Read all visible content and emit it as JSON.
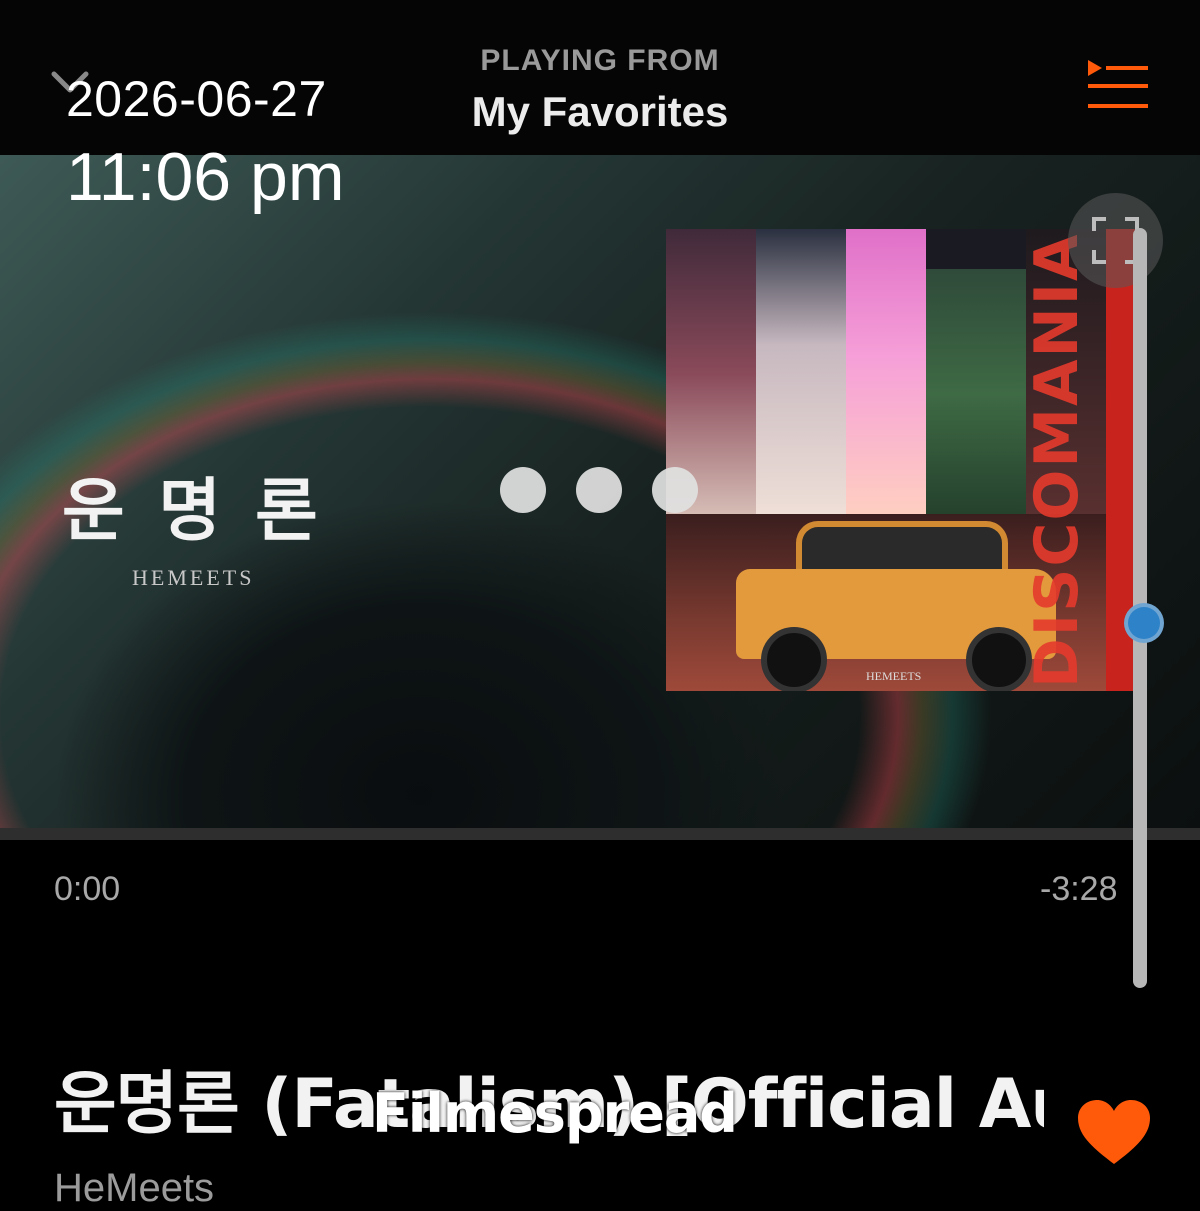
{
  "status_overlay": {
    "date": "2026-06-27",
    "time": "11:06 pm"
  },
  "header": {
    "playing_from_label": "PLAYING FROM",
    "playlist_name": "My Favorites"
  },
  "video": {
    "title_text": "운명론",
    "artist_text": "HEMEETS",
    "album_cover": {
      "vertical_text": "DISCOMANIA",
      "label": "HEMEETS"
    }
  },
  "progress": {
    "elapsed": "0:00",
    "remaining": "-3:28",
    "fraction": 0.0
  },
  "volume": {
    "level": 0.48
  },
  "track": {
    "title": "운명론 (Fatalism) [Official Audio]",
    "artist": "HeMeets"
  },
  "watermark": "Filmespread",
  "icons": [
    "chevron-down-icon",
    "queue-icon",
    "fullscreen-icon",
    "heart-icon",
    "more-dots-icon"
  ],
  "colors": {
    "accent": "#ff5a0a",
    "volume_thumb": "#2d82c8",
    "background": "#000000"
  }
}
